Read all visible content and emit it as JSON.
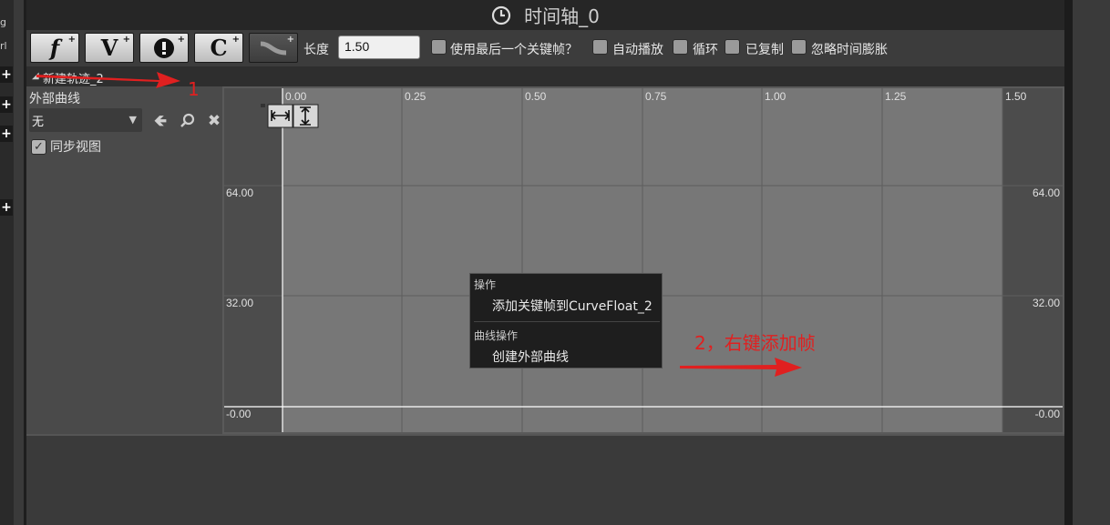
{
  "left_edge": {
    "fragment_1": "g",
    "fragment_2": "rl"
  },
  "title": {
    "text": "时间轴_0",
    "icon": "clock-icon"
  },
  "toolbar": {
    "buttons": [
      {
        "glyph": "f",
        "icon": "add-float-track-icon"
      },
      {
        "glyph": "V",
        "icon": "add-vector-track-icon"
      },
      {
        "glyph": "!",
        "icon": "add-event-track-icon"
      },
      {
        "glyph": "C",
        "icon": "add-color-track-icon"
      },
      {
        "glyph": "~",
        "icon": "add-curve-asset-icon"
      }
    ],
    "length_label": "长度",
    "length_value": "1.50",
    "use_last_keyframe_label": "使用最后一个关键帧？",
    "autoplay_label": "自动播放",
    "loop_label": "循环",
    "replicated_label": "已复制",
    "ignore_time_dilation_label": "忽略时间膨胀"
  },
  "track": {
    "name": "新建轨迹_2"
  },
  "left_panel": {
    "external_curve_label": "外部曲线",
    "dropdown_value": "无",
    "sync_view_label": "同步视图",
    "sync_view_checked": true
  },
  "graph": {
    "x_ticks": [
      "0.00",
      "0.25",
      "0.50",
      "0.75",
      "1.00",
      "1.25",
      "1.50"
    ],
    "y_ticks": [
      "64.00",
      "32.00",
      "-0.00"
    ],
    "colors": {
      "bg": "#4c4c4c",
      "active": "#777777",
      "grid": "#5a5a5a",
      "axis": "#ffffff"
    }
  },
  "context_menu": {
    "section_1": "操作",
    "item_1": "添加关键帧到CurveFloat_2",
    "section_2": "曲线操作",
    "item_2": "创建外部曲线"
  },
  "annotations": {
    "a1": "1",
    "a2": "2，右键添加帧",
    "color": "#e02020"
  }
}
